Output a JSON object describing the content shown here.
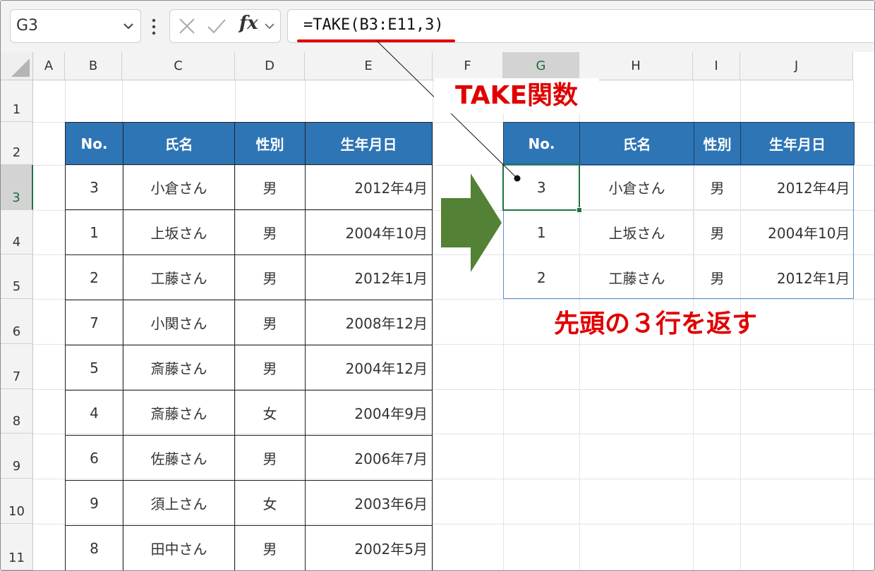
{
  "formula_bar": {
    "name_box": "G3",
    "fx": "fx",
    "formula": "=TAKE(B3:E11,3)"
  },
  "grid": {
    "columns": [
      "A",
      "B",
      "C",
      "D",
      "E",
      "F",
      "G",
      "H",
      "I",
      "J"
    ],
    "rows": [
      "1",
      "2",
      "3",
      "4",
      "5",
      "6",
      "7",
      "8",
      "9",
      "10",
      "11"
    ],
    "selected_column": "G",
    "selected_row": "3"
  },
  "source_table": {
    "headers": [
      "No.",
      "氏名",
      "性別",
      "生年月日"
    ],
    "rows": [
      [
        "3",
        "小倉さん",
        "男",
        "2012年4月"
      ],
      [
        "1",
        "上坂さん",
        "男",
        "2004年10月"
      ],
      [
        "2",
        "工藤さん",
        "男",
        "2012年1月"
      ],
      [
        "7",
        "小関さん",
        "男",
        "2008年12月"
      ],
      [
        "5",
        "斎藤さん",
        "男",
        "2004年12月"
      ],
      [
        "4",
        "斎藤さん",
        "女",
        "2004年9月"
      ],
      [
        "6",
        "佐藤さん",
        "男",
        "2006年7月"
      ],
      [
        "9",
        "須上さん",
        "女",
        "2003年6月"
      ],
      [
        "8",
        "田中さん",
        "男",
        "2002年5月"
      ]
    ]
  },
  "result_table": {
    "headers": [
      "No.",
      "氏名",
      "性別",
      "生年月日"
    ],
    "rows": [
      [
        "3",
        "小倉さん",
        "男",
        "2012年4月"
      ],
      [
        "1",
        "上坂さん",
        "男",
        "2004年10月"
      ],
      [
        "2",
        "工藤さん",
        "男",
        "2012年1月"
      ]
    ]
  },
  "annotations": {
    "function_label": "TAKE関数",
    "result_label": "先頭の３行を返す"
  },
  "colors": {
    "header_fill": "#2e75b6",
    "accent_red": "#e00000",
    "arrow_green": "#538135",
    "selection_green": "#217346"
  }
}
